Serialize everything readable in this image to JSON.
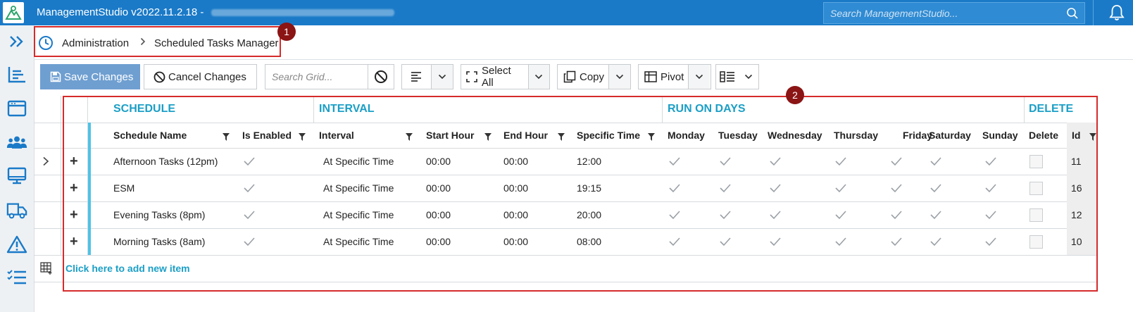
{
  "app": {
    "title": "ManagementStudio v2022.11.2.18 - ",
    "search_placeholder": "Search ManagementStudio..."
  },
  "breadcrumb": {
    "items": [
      "Administration",
      "Scheduled Tasks Manager"
    ]
  },
  "annotations": [
    "1",
    "2"
  ],
  "toolbar": {
    "save_label": "Save Changes",
    "cancel_label": "Cancel Changes",
    "search_placeholder": "Search Grid...",
    "select_all_label": "Select All",
    "copy_label": "Copy",
    "pivot_label": "Pivot"
  },
  "grid": {
    "groups": {
      "schedule": "SCHEDULE",
      "interval": "INTERVAL",
      "run_on_days": "RUN ON DAYS",
      "delete": "DELETE"
    },
    "columns": {
      "schedule_name": "Schedule Name",
      "is_enabled": "Is Enabled",
      "interval": "Interval",
      "start_hour": "Start Hour",
      "end_hour": "End Hour",
      "specific_time": "Specific Time",
      "monday": "Monday",
      "tuesday": "Tuesday",
      "wednesday": "Wednesday",
      "thursday": "Thursday",
      "friday": "Friday",
      "saturday": "Saturday",
      "sunday": "Sunday",
      "delete": "Delete",
      "id": "Id"
    },
    "rows": [
      {
        "name": "Afternoon Tasks (12pm)",
        "interval": "At Specific Time",
        "start": "00:00",
        "end": "00:00",
        "time": "12:00",
        "id": "11",
        "enabled": true,
        "days": [
          true,
          true,
          true,
          true,
          true,
          true,
          true
        ],
        "delete": false
      },
      {
        "name": "ESM",
        "interval": "At Specific Time",
        "start": "00:00",
        "end": "00:00",
        "time": "19:15",
        "id": "16",
        "enabled": true,
        "days": [
          true,
          true,
          true,
          true,
          true,
          true,
          true
        ],
        "delete": false
      },
      {
        "name": "Evening Tasks (8pm)",
        "interval": "At Specific Time",
        "start": "00:00",
        "end": "00:00",
        "time": "20:00",
        "id": "12",
        "enabled": true,
        "days": [
          true,
          true,
          true,
          true,
          true,
          true,
          true
        ],
        "delete": false
      },
      {
        "name": "Morning Tasks (8am)",
        "interval": "At Specific Time",
        "start": "00:00",
        "end": "00:00",
        "time": "08:00",
        "id": "10",
        "enabled": true,
        "days": [
          true,
          true,
          true,
          true,
          true,
          true,
          true
        ],
        "delete": false
      }
    ],
    "add_item_label": "Click here to add new item"
  },
  "colors": {
    "titlebar": "#1a7ac8",
    "accent": "#1b9fc6",
    "annotation": "#d62b2b",
    "save_button": "#6f9fd1"
  },
  "icons": [
    "app-logo-icon",
    "search-icon",
    "bell-icon",
    "expand-nav-icon",
    "dashboard-icon",
    "calendar-icon",
    "users-icon",
    "monitor-icon",
    "truck-icon",
    "warning-icon",
    "checklist-icon",
    "clock-icon",
    "chevron-right-icon",
    "save-icon",
    "cancel-icon",
    "clear-search-icon",
    "align-left-icon",
    "select-all-icon",
    "copy-icon",
    "pivot-icon",
    "column-chooser-icon",
    "filter-icon",
    "add-row-icon"
  ]
}
